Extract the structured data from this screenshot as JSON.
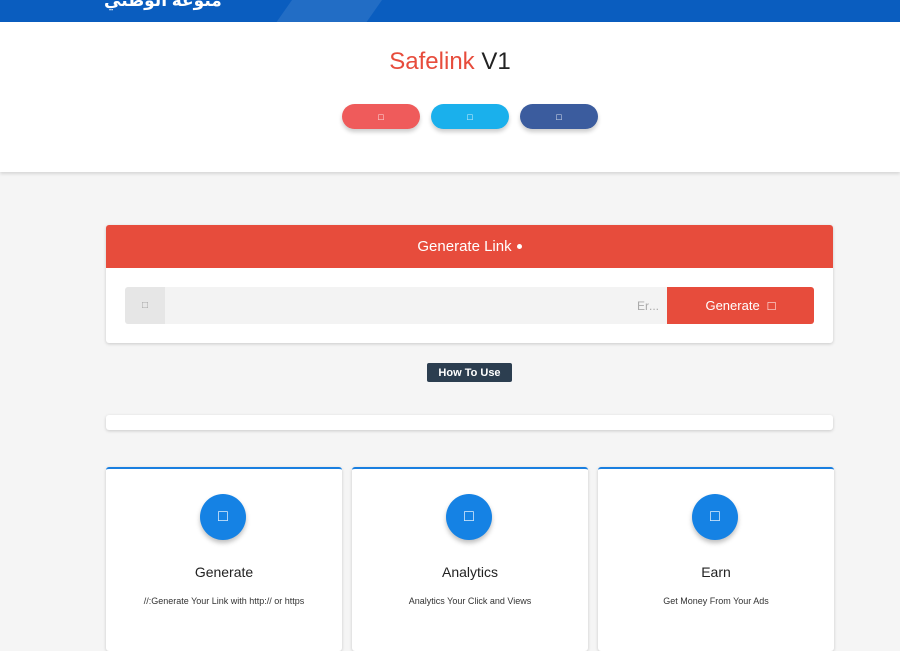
{
  "topbar": {
    "brand": "منوعة الوطني"
  },
  "hero": {
    "title_part1": "Safelink",
    "title_part2": " V1",
    "social_buttons": [
      {
        "icon": "□",
        "color": "#ef5b5b"
      },
      {
        "icon": "□",
        "color": "#1ab0ec"
      },
      {
        "icon": "□",
        "color": "#3b5c9e"
      }
    ]
  },
  "generator": {
    "header": "Generate Link",
    "input_icon": "□",
    "input_placeholder": "...Er",
    "button_label": "Generate",
    "button_icon": "□"
  },
  "howto": {
    "label": "How To Use"
  },
  "features": [
    {
      "icon": "□",
      "title": "Generate",
      "desc": "//:Generate Your Link with http:// or https"
    },
    {
      "icon": "□",
      "title": "Analytics",
      "desc": "Analytics Your Click and Views"
    },
    {
      "icon": "□",
      "title": "Earn",
      "desc": "Get Money From Your Ads"
    }
  ],
  "colors": {
    "topbar": "#0a5dbf",
    "accent_red": "#e74c3c",
    "feature_blue": "#1582e4",
    "howto_bg": "#2c3e50"
  }
}
